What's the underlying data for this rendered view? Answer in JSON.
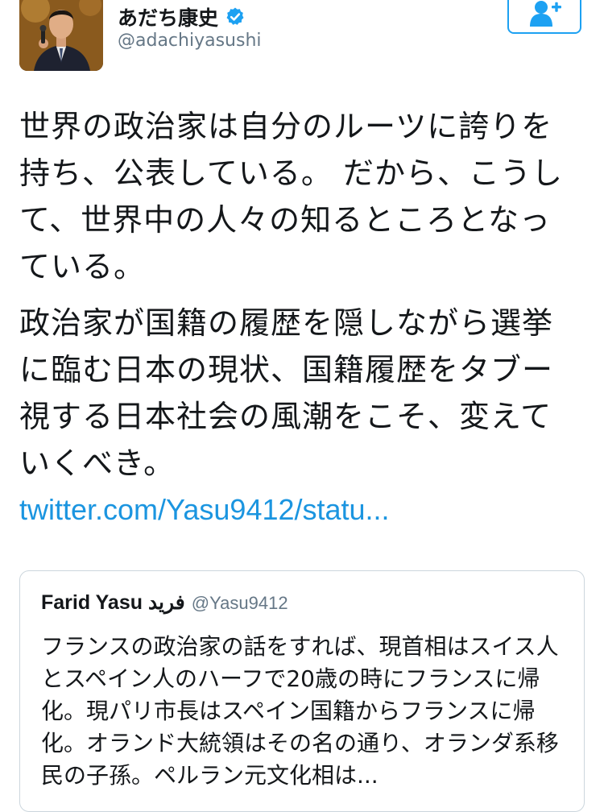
{
  "header": {
    "display_name": "あだち康史",
    "handle": "@adachiyasushi",
    "verified": true
  },
  "tweet": {
    "paragraphs": [
      "世界の政治家は自分のルーツに誇りを持ち、公表している。 だから、こうして、世界中の人々の知るところとなっている。",
      "政治家が国籍の履歴を隠しながら選挙に臨む日本の現状、国籍履歴をタブー視する日本社会の風潮をこそ、変えていくべき。"
    ],
    "link": "twitter.com/Yasu9412/statu..."
  },
  "quoted_tweet": {
    "name": "Farid Yasu فريد",
    "handle": "@Yasu9412",
    "text": "フランスの政治家の話をすれば、現首相はスイス人とスペイン人のハーフで20歳の時にフランスに帰化。現パリ市長はスペイン国籍からフランスに帰化。オランド大統領はその名の通り、オランダ系移民の子孫。ペルラン元文化相は..."
  },
  "icons": {
    "follow": "add-user-icon",
    "verified": "verified-badge-icon"
  },
  "colors": {
    "accent": "#1da1f2",
    "link": "#1b95e0",
    "secondary_text": "#657786",
    "border": "#ccd6dd"
  }
}
